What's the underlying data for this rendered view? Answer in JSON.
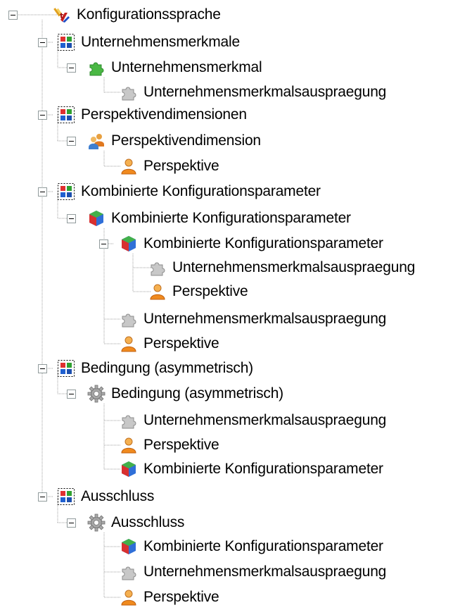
{
  "colors": {
    "tree_lines": "#a0a0a0",
    "toggle_border": "#919b9c",
    "text": "#000000",
    "background": "#ffffff"
  },
  "tree": {
    "nodes": [
      {
        "label": "Konfigurationssprache",
        "icon": "language-icon",
        "expanded": true
      },
      {
        "label": "Unternehmensmerkmale",
        "icon": "folder-icon",
        "expanded": true
      },
      {
        "label": "Unternehmensmerkmal",
        "icon": "puzzle-green-icon",
        "expanded": true
      },
      {
        "label": "Unternehmensmerkmalsauspraegung",
        "icon": "puzzle-gray-icon",
        "expanded": false
      },
      {
        "label": "Perspektivendimensionen",
        "icon": "folder-icon",
        "expanded": true
      },
      {
        "label": "Perspektivendimension",
        "icon": "users-icon",
        "expanded": true
      },
      {
        "label": "Perspektive",
        "icon": "user-icon",
        "expanded": false
      },
      {
        "label": "Kombinierte Konfigurationsparameter",
        "icon": "folder-icon",
        "expanded": true
      },
      {
        "label": "Kombinierte Konfigurationsparameter",
        "icon": "cube-icon",
        "expanded": true
      },
      {
        "label": "Kombinierte Konfigurationsparameter",
        "icon": "cube-icon",
        "expanded": true
      },
      {
        "label": "Unternehmensmerkmalsauspraegung",
        "icon": "puzzle-gray-icon",
        "expanded": false
      },
      {
        "label": "Perspektive",
        "icon": "user-icon",
        "expanded": false
      },
      {
        "label": "Unternehmensmerkmalsauspraegung",
        "icon": "puzzle-gray-icon",
        "expanded": false
      },
      {
        "label": "Perspektive",
        "icon": "user-icon",
        "expanded": false
      },
      {
        "label": "Bedingung (asymmetrisch)",
        "icon": "folder-icon",
        "expanded": true
      },
      {
        "label": "Bedingung (asymmetrisch)",
        "icon": "gear-icon",
        "expanded": true
      },
      {
        "label": "Unternehmensmerkmalsauspraegung",
        "icon": "puzzle-gray-icon",
        "expanded": false
      },
      {
        "label": "Perspektive",
        "icon": "user-icon",
        "expanded": false
      },
      {
        "label": "Kombinierte Konfigurationsparameter",
        "icon": "cube-icon",
        "expanded": false
      },
      {
        "label": "Ausschluss",
        "icon": "folder-icon",
        "expanded": true
      },
      {
        "label": "Ausschluss",
        "icon": "gear-icon",
        "expanded": true
      },
      {
        "label": "Kombinierte Konfigurationsparameter",
        "icon": "cube-icon",
        "expanded": false
      },
      {
        "label": "Unternehmensmerkmalsauspraegung",
        "icon": "puzzle-gray-icon",
        "expanded": false
      },
      {
        "label": "Perspektive",
        "icon": "user-icon",
        "expanded": false
      }
    ]
  }
}
